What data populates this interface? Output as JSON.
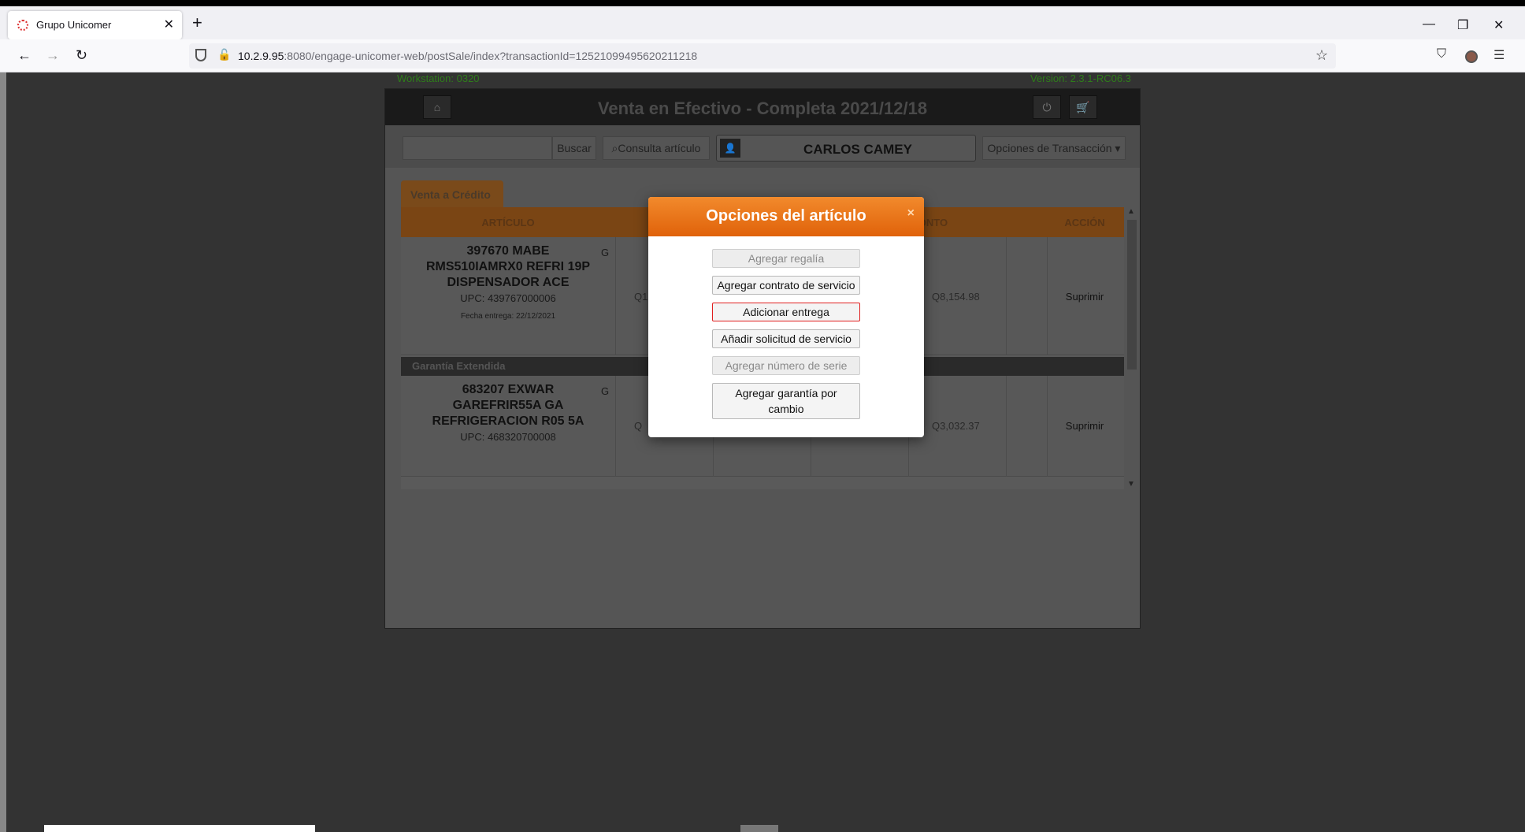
{
  "browser": {
    "tab_title": "Grupo Unicomer",
    "tab_close": "✕",
    "new_tab": "+",
    "url_host": "10.2.9.95",
    "url_path": ":8080/engage-unicomer-web/postSale/index?transactionId=12521099495620211218",
    "window_controls": [
      "—",
      "❐",
      "✕"
    ],
    "nav": {
      "back": "←",
      "forward": "→",
      "reload": "↻"
    }
  },
  "page": {
    "workstation_label": "Workstation: 0320",
    "version_label": "Version: 2.3.1-RC06.3",
    "title": "Venta en Efectivo - Completa 2021/12/18",
    "search_button": "Buscar",
    "consulta_button": "Consulta artículo",
    "customer_name": "CARLOS CAMEY",
    "options_button": "Opciones de Transacción ▾",
    "tab_label": "Venta a Crédito",
    "columns": [
      "ARTÍCULO",
      "MONTO",
      "ACCIÓN"
    ],
    "rows": [
      {
        "name": "397670 MABE RMS510IAMRX0 REFRI 19P DISPENSADOR ACE",
        "upc": "UPC: 439767000006",
        "delivery": "Fecha entrega: 22/12/2021",
        "flag": "G",
        "price_partial": "Q1",
        "amount": "Q8,154.98",
        "action": "Suprimir"
      },
      {
        "name": "683207 EXWAR GAREFRIR55A GA REFRIGERACION R05 5A",
        "upc": "UPC: 468320700008",
        "flag": "G",
        "price_partial": "Q",
        "amount": "Q3,032.37",
        "action": "Suprimir"
      }
    ],
    "section_label": "Garantía Extendida"
  },
  "modal": {
    "title": "Opciones del artículo",
    "close": "×",
    "options": [
      {
        "label": "Agregar regalía",
        "state": "disabled"
      },
      {
        "label": "Agregar contrato de servicio",
        "state": "enabled"
      },
      {
        "label": "Adicionar entrega",
        "state": "selected"
      },
      {
        "label": "Añadir solicitud de servicio",
        "state": "enabled"
      },
      {
        "label": "Agregar número de serie",
        "state": "disabled"
      },
      {
        "label": "Agregar garantía por cambio",
        "state": "enabled"
      }
    ]
  },
  "colors": {
    "modal_header": "#e86f14",
    "selected_border": "#e02020"
  }
}
